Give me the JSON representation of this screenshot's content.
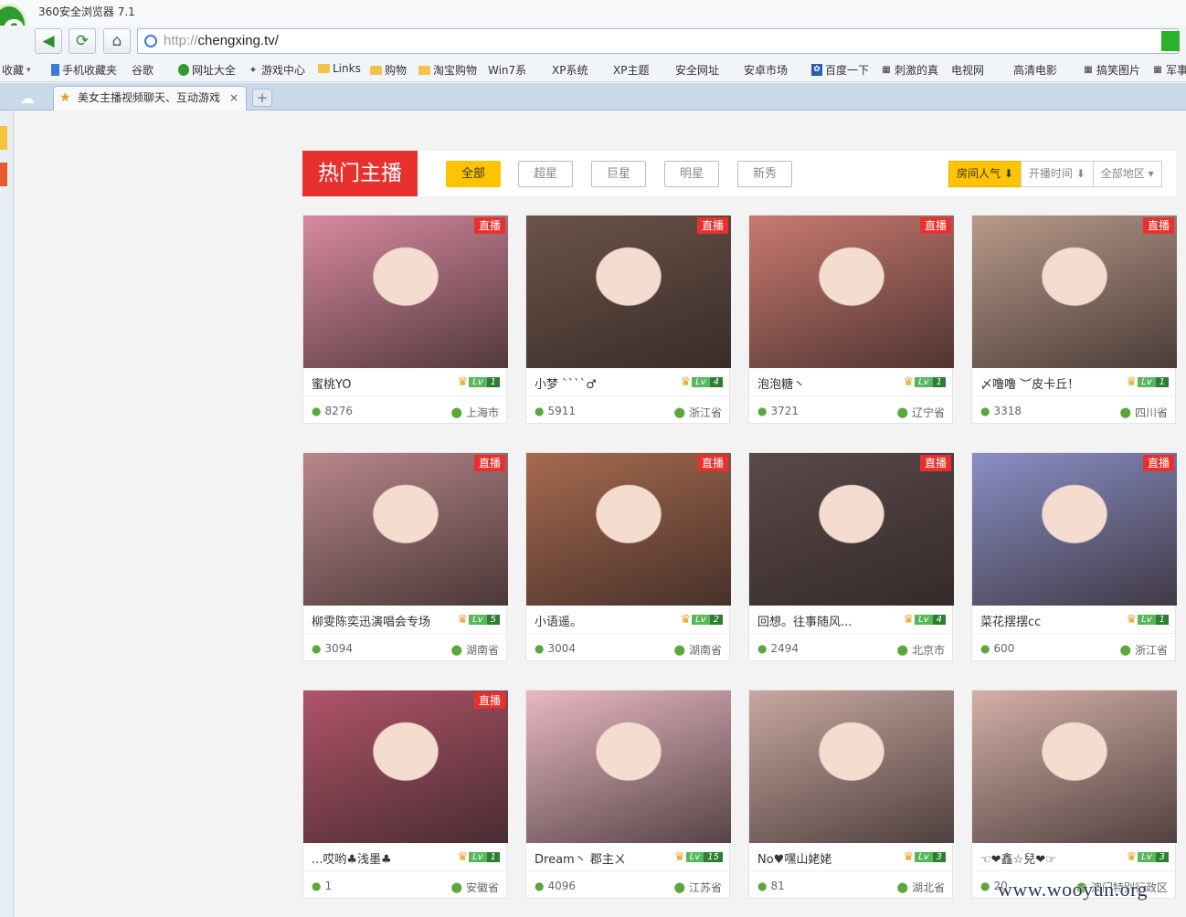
{
  "browser": {
    "window_title": "360安全浏览器 7.1",
    "address": {
      "protocol": "http://",
      "host": "chengxing.tv/"
    },
    "bookmarks": [
      "收藏",
      "手机收藏夹",
      "谷歌",
      "网址大全",
      "游戏中心",
      "Links",
      "购物",
      "淘宝购物",
      "Win7系",
      "XP系统",
      "XP主题",
      "安全网址",
      "安卓市场",
      "百度一下",
      "刺激的真",
      "电视网",
      "高清电影",
      "搞笑图片",
      "军事"
    ],
    "tab_title": "美女主播视频聊天、互动游戏",
    "tab_close": "×",
    "new_tab": "+"
  },
  "filter": {
    "heading": "热门主播",
    "categories": [
      "全部",
      "超星",
      "巨星",
      "明星",
      "新秀"
    ],
    "sort": [
      "房间人气 ⬇",
      "开播时间 ⬇",
      "全部地区 ▾"
    ]
  },
  "live_label": "直播",
  "lv_prefix": "Lv",
  "streamers": [
    {
      "name": "蜜桃YO",
      "level": "1",
      "viewers": "8276",
      "location": "上海市",
      "live": true,
      "thumb": "#d88aa0"
    },
    {
      "name": "小梦 ˋˋˋˋ♂",
      "level": "4",
      "viewers": "5911",
      "location": "浙江省",
      "live": true,
      "thumb": "#6b5448"
    },
    {
      "name": "泡泡糖丶",
      "level": "1",
      "viewers": "3721",
      "location": "辽宁省",
      "live": true,
      "thumb": "#c97a70"
    },
    {
      "name": "〆噜噜 ︶皮卡丘！",
      "level": "1",
      "viewers": "3318",
      "location": "四川省",
      "live": true,
      "thumb": "#b89a8a"
    },
    {
      "name": "柳雯陈奕迅演唱会专场",
      "level": "5",
      "viewers": "3094",
      "location": "湖南省",
      "live": true,
      "thumb": "#b8878a"
    },
    {
      "name": "小语遥。",
      "level": "2",
      "viewers": "3004",
      "location": "湖南省",
      "live": true,
      "thumb": "#a66a4e"
    },
    {
      "name": "回想。往事随风...",
      "level": "4",
      "viewers": "2494",
      "location": "北京市",
      "live": true,
      "thumb": "#5a4a4a"
    },
    {
      "name": "菜花摆摆cc",
      "level": "1",
      "viewers": "600",
      "location": "浙江省",
      "live": true,
      "thumb": "#8a8fc4"
    },
    {
      "name": "...哎哟♣浅墨♣",
      "level": "1",
      "viewers": "1",
      "location": "安徽省",
      "live": true,
      "thumb": "#b0546a"
    },
    {
      "name": "Dream丶 郡主ㄨ",
      "level": "15",
      "viewers": "4096",
      "location": "江苏省",
      "live": false,
      "thumb": "#e8b8c4"
    },
    {
      "name": "No♥嘿山姥姥",
      "level": "3",
      "viewers": "81",
      "location": "湖北省",
      "live": false,
      "thumb": "#c8a8a0"
    },
    {
      "name": "☜❤鑫☆兒❤☞",
      "level": "3",
      "viewers": "20",
      "location": "澳门特别行政区",
      "live": false,
      "thumb": "#d4b0a8"
    }
  ],
  "watermark": "www.wooyun.org"
}
